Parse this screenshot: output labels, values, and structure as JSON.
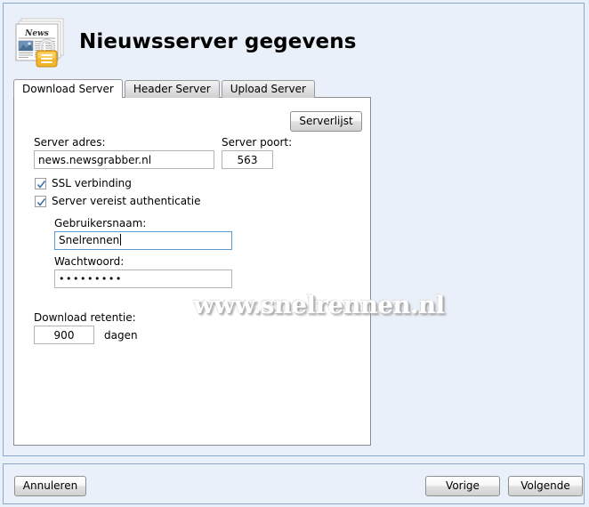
{
  "window": {
    "title": "Nieuwsserver gegevens",
    "icon": "newspaper-lock-icon"
  },
  "tabs": [
    {
      "label": "Download Server",
      "active": true
    },
    {
      "label": "Header Server",
      "active": false
    },
    {
      "label": "Upload Server",
      "active": false
    }
  ],
  "form": {
    "serverlist_button": "Serverlijst",
    "server_address_label": "Server adres:",
    "server_address_value": "news.newsgrabber.nl",
    "server_port_label": "Server poort:",
    "server_port_value": "563",
    "ssl_label": "SSL verbinding",
    "ssl_checked": true,
    "auth_label": "Server vereist authenticatie",
    "auth_checked": true,
    "username_label": "Gebruikersnaam:",
    "username_value": "Snelrennen",
    "password_label": "Wachtwoord:",
    "password_value": "•••••••••",
    "retention_label": "Download retentie:",
    "retention_value": "900",
    "retention_unit": "dagen"
  },
  "watermark": {
    "text": "www.snelrennen.nl"
  },
  "footer": {
    "cancel": "Annuleren",
    "back": "Vorige",
    "next": "Volgende"
  },
  "colors": {
    "window_background": "#eaf0f9",
    "window_border": "#8aa8cc",
    "panel_background": "#ffffff",
    "panel_border": "#8c8c8c",
    "focus_border": "#5b9bd5",
    "checkmark": "#3f6fa8",
    "lock_icon": "#f0b429"
  }
}
